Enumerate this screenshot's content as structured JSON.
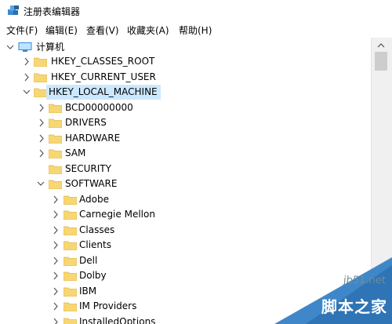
{
  "window": {
    "title": "注册表编辑器"
  },
  "menu": [
    "文件(F)",
    "编辑(E)",
    "查看(V)",
    "收藏夹(A)",
    "帮助(H)"
  ],
  "tree": {
    "root_label": "计算机",
    "hkey_classes_root": "HKEY_CLASSES_ROOT",
    "hkey_current_user": "HKEY_CURRENT_USER",
    "hkey_local_machine": "HKEY_LOCAL_MACHINE",
    "hklm_children": {
      "bcd": "BCD00000000",
      "drivers": "DRIVERS",
      "hardware": "HARDWARE",
      "sam": "SAM",
      "security": "SECURITY",
      "software": "SOFTWARE"
    },
    "software_children": [
      "Adobe",
      "Carnegie Mellon",
      "Classes",
      "Clients",
      "Dell",
      "Dolby",
      "IBM",
      "IM Providers",
      "InstalledOptions"
    ]
  },
  "watermark": {
    "url": "jb51.net",
    "name": "脚本之家"
  },
  "colors": {
    "selection": "#cce8ff",
    "folder": "#f7d774",
    "folder_dark": "#e0b64a",
    "chevron": "#555555",
    "computer": "#3a8ad6"
  },
  "icons": {
    "expanded": "chevron-down-icon",
    "collapsed": "chevron-right-icon",
    "folder": "folder-icon",
    "computer": "computer-icon"
  }
}
